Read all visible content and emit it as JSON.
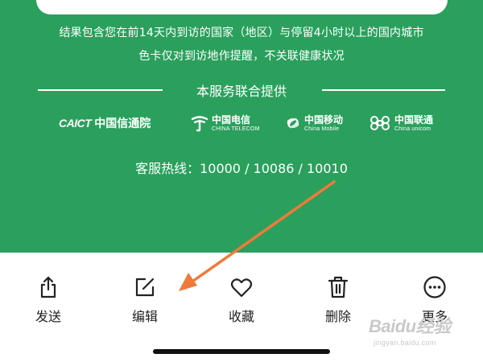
{
  "info": {
    "line1": "结果包含您在前14天内到访的国家（地区）与停留4小时以上的国内城市",
    "line2": "色卡仅对到访地作提醒，不关联健康状况"
  },
  "providers": {
    "title": "本服务联合提供",
    "caict": {
      "mark": "CAICT",
      "name": "中国信通院"
    },
    "telecom": {
      "cn": "中国电信",
      "en": "CHINA TELECOM"
    },
    "mobile": {
      "cn": "中国移动",
      "en": "China Mobile"
    },
    "unicom": {
      "cn": "中国联通",
      "en": "China unicom"
    }
  },
  "hotline": "客服热线：10000  /  10086  /  10010",
  "actions": {
    "send": "发送",
    "edit": "编辑",
    "favorite": "收藏",
    "delete": "删除",
    "more": "更多"
  },
  "watermark": {
    "main": "Baidu经验",
    "sub": "jingyan.baidu.com"
  },
  "colors": {
    "green_background": "#2aa05c",
    "annotation_arrow": "#f07a3a",
    "icon_stroke": "#222222"
  }
}
